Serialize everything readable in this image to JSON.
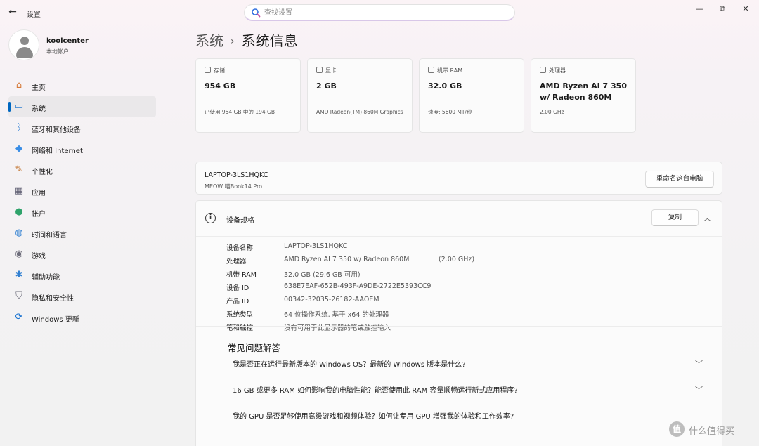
{
  "titlebar": {
    "back": "←",
    "title": "设置",
    "search_placeholder": "查找设置",
    "minimize": "—",
    "maximize": "⧉",
    "close": "✕"
  },
  "profile": {
    "name": "koolcenter",
    "account_type": "本地帐户"
  },
  "sidebar": {
    "items": [
      {
        "label": "主页",
        "icon": "home-icon",
        "glyph": "⌂",
        "color": "#d67a3a"
      },
      {
        "label": "系统",
        "icon": "system-icon",
        "glyph": "▭",
        "color": "#2f7fd1"
      },
      {
        "label": "蓝牙和其他设备",
        "icon": "bluetooth-icon",
        "glyph": "ᛒ",
        "color": "#1a73d1"
      },
      {
        "label": "网络和 Internet",
        "icon": "network-icon",
        "glyph": "◆",
        "color": "#3a8ee6"
      },
      {
        "label": "个性化",
        "icon": "personalization-icon",
        "glyph": "✎",
        "color": "#c0702a"
      },
      {
        "label": "应用",
        "icon": "apps-icon",
        "glyph": "▦",
        "color": "#5a5a6e"
      },
      {
        "label": "帐户",
        "icon": "accounts-icon",
        "glyph": "●",
        "color": "#2fa36b"
      },
      {
        "label": "时间和语言",
        "icon": "time-language-icon",
        "glyph": "◍",
        "color": "#2f7fd1"
      },
      {
        "label": "游戏",
        "icon": "gaming-icon",
        "glyph": "◉",
        "color": "#6d6d7a"
      },
      {
        "label": "辅助功能",
        "icon": "accessibility-icon",
        "glyph": "✱",
        "color": "#2f7fd1"
      },
      {
        "label": "隐私和安全性",
        "icon": "privacy-icon",
        "glyph": "⛉",
        "color": "#6d6d7a"
      },
      {
        "label": "Windows 更新",
        "icon": "windows-update-icon",
        "glyph": "⟳",
        "color": "#1a73d1"
      }
    ],
    "active_index": 1
  },
  "breadcrumb": {
    "parent": "系统",
    "separator": "›",
    "current": "系统信息"
  },
  "cards": [
    {
      "label": "存储",
      "value": "954 GB",
      "sub": "已使用 954 GB 中的 194 GB"
    },
    {
      "label": "显卡",
      "value": "2 GB",
      "sub": "AMD Radeon(TM) 860M Graphics"
    },
    {
      "label": "机带 RAM",
      "value": "32.0 GB",
      "sub": "速度: 5600 MT/秒"
    },
    {
      "label": "处理器",
      "value": "AMD Ryzen AI 7 350 w/ Radeon 860M",
      "sub": "2.00 GHz"
    }
  ],
  "device": {
    "name": "LAPTOP-3LS1HQKC",
    "model": "MEOW 喵Book14 Pro",
    "rename_label": "重命名这台电脑"
  },
  "specs": {
    "title": "设备规格",
    "copy_label": "复制",
    "rows": [
      {
        "key": "设备名称",
        "value": "LAPTOP-3LS1HQKC",
        "extra": ""
      },
      {
        "key": "处理器",
        "value": "AMD Ryzen AI 7 350 w/ Radeon 860M",
        "extra": "(2.00 GHz)"
      },
      {
        "key": "机带 RAM",
        "value": "32.0 GB (29.6 GB 可用)",
        "extra": ""
      },
      {
        "key": "设备 ID",
        "value": "638E7EAF-652B-493F-A9DE-2722E5393CC9",
        "extra": ""
      },
      {
        "key": "产品 ID",
        "value": "00342-32035-26182-AAOEM",
        "extra": ""
      },
      {
        "key": "系统类型",
        "value": "64 位操作系统, 基于 x64 的处理器",
        "extra": ""
      },
      {
        "key": "笔和触控",
        "value": "没有可用于此显示器的笔或触控输入",
        "extra": ""
      }
    ]
  },
  "faq": {
    "title": "常见问题解答",
    "items": [
      "我是否正在运行最新版本的 Windows OS？最新的 Windows 版本是什么?",
      "16 GB 或更多 RAM 如何影响我的电脑性能？能否使用此 RAM 容量顺畅运行新式应用程序?",
      "我的 GPU 是否足够使用高级游戏和视频体验？如何让专用 GPU 增强我的体验和工作效率?"
    ]
  },
  "watermark": {
    "glyph": "值",
    "text": "什么值得买"
  }
}
